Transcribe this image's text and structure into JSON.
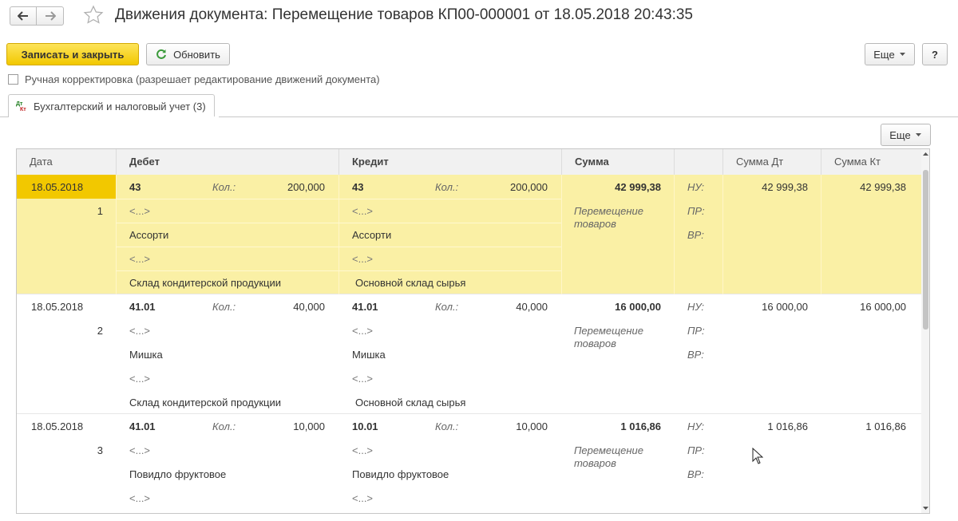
{
  "window": {
    "title": "Движения документа: Перемещение товаров КП00-000001 от 18.05.2018 20:43:35"
  },
  "toolbar": {
    "save_close": "Записать и закрыть",
    "refresh": "Обновить",
    "more": "Еще",
    "help": "?"
  },
  "manual_correction": {
    "label": "Ручная корректировка (разрешает редактирование движений документа)",
    "checked": false
  },
  "tab": {
    "label": "Бухгалтерский и налоговый учет (3)"
  },
  "grid": {
    "more": "Еще",
    "columns": [
      "Дата",
      "Дебет",
      "Кредит",
      "Сумма",
      "",
      "Сумма Дт",
      "Сумма Кт"
    ],
    "rows": [
      {
        "date": "18.05.2018",
        "num": "1",
        "debit_account": "43",
        "qty_label": "Кол.:",
        "debit_qty": "200,000",
        "debit_sub1": "<...>",
        "debit_sub2": "Ассорти",
        "debit_sub3": "<...>",
        "debit_sub4": "Склад кондитерской продукции",
        "credit_account": "43",
        "credit_qty": "200,000",
        "credit_sub1": "<...>",
        "credit_sub2": "Ассорти",
        "credit_sub3": "<...>",
        "credit_sub4": "Основной склад сырья",
        "sum": "42 999,38",
        "content": "Перемещение товаров",
        "nu": "НУ:",
        "pr": "ПР:",
        "vr": "ВР:",
        "sum_dt": "42 999,38",
        "sum_kt": "42 999,38",
        "selected": true
      },
      {
        "date": "18.05.2018",
        "num": "2",
        "debit_account": "41.01",
        "qty_label": "Кол.:",
        "debit_qty": "40,000",
        "debit_sub1": "<...>",
        "debit_sub2": "Мишка",
        "debit_sub3": "<...>",
        "debit_sub4": "Склад кондитерской продукции",
        "credit_account": "41.01",
        "credit_qty": "40,000",
        "credit_sub1": "<...>",
        "credit_sub2": "Мишка",
        "credit_sub3": "<...>",
        "credit_sub4": "Основной склад сырья",
        "sum": "16 000,00",
        "content": "Перемещение товаров",
        "nu": "НУ:",
        "pr": "ПР:",
        "vr": "ВР:",
        "sum_dt": "16 000,00",
        "sum_kt": "16 000,00",
        "selected": false
      },
      {
        "date": "18.05.2018",
        "num": "3",
        "debit_account": "41.01",
        "qty_label": "Кол.:",
        "debit_qty": "10,000",
        "debit_sub1": "<...>",
        "debit_sub2": "Повидло фруктовое",
        "debit_sub3": "<...>",
        "debit_sub4": "",
        "credit_account": "10.01",
        "credit_qty": "10,000",
        "credit_sub1": "<...>",
        "credit_sub2": "Повидло фруктовое",
        "credit_sub3": "<...>",
        "credit_sub4": "",
        "sum": "1 016,86",
        "content": "Перемещение товаров",
        "nu": "НУ:",
        "pr": "ПР:",
        "vr": "ВР:",
        "sum_dt": "1 016,86",
        "sum_kt": "1 016,86",
        "selected": false
      }
    ]
  },
  "colors": {
    "primary_button": "#f2c800",
    "selected_row": "#faf0a5",
    "selected_date": "#f2c800"
  },
  "icons": {
    "back": "arrow-left-icon",
    "forward": "arrow-right-icon",
    "favorite": "star-icon",
    "refresh": "refresh-icon",
    "tab": "dt-kt-icon",
    "dropdown": "caret-down-icon"
  }
}
